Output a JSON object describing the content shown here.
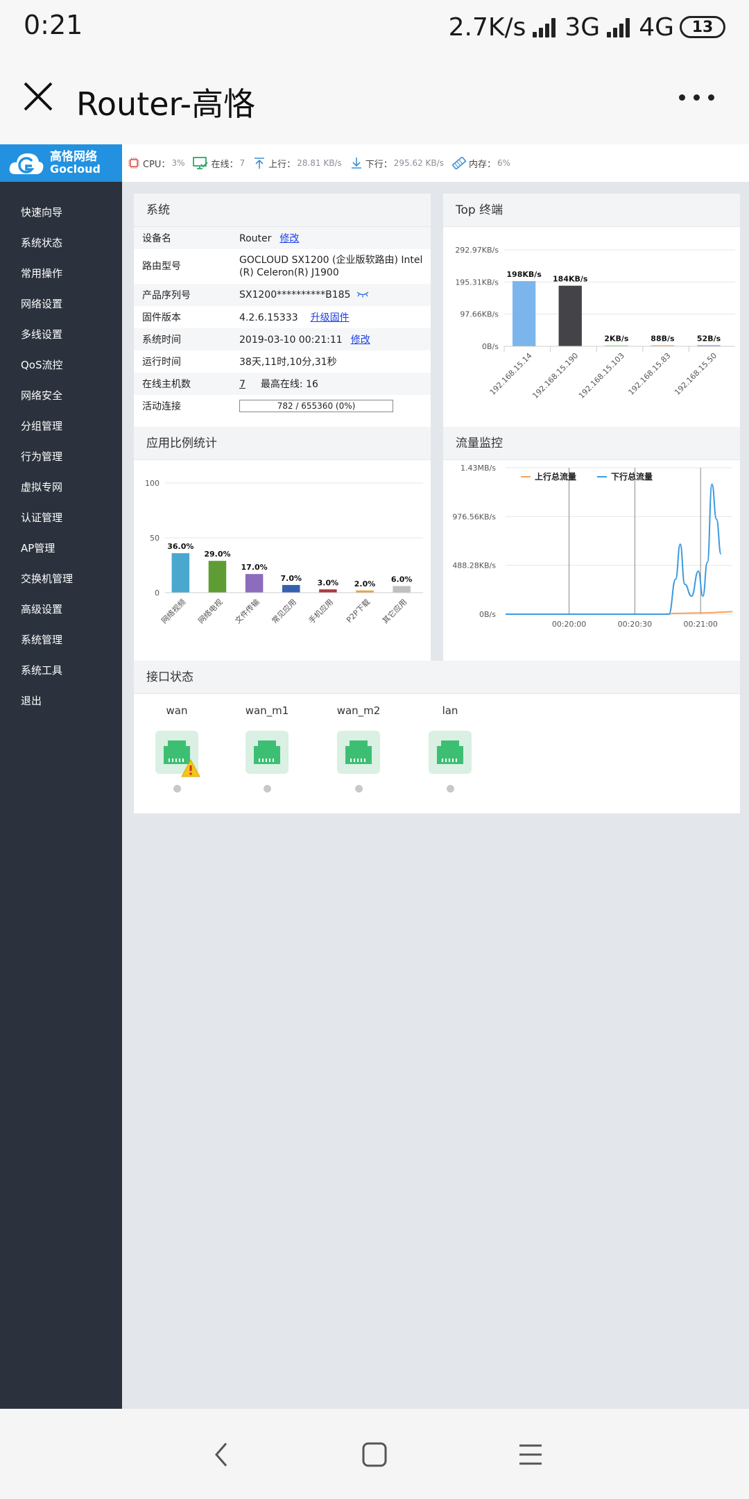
{
  "status_bar": {
    "time": "0:21",
    "net_speed": "2.7K/s",
    "net1": "3G",
    "net2": "4G",
    "battery": "13"
  },
  "title_bar": {
    "title": "Router-高恪"
  },
  "logo": {
    "cn": "高恪网络",
    "en": "Gocloud"
  },
  "sidebar": {
    "items": [
      "快速向导",
      "系统状态",
      "常用操作",
      "网络设置",
      "多线设置",
      "QoS流控",
      "网络安全",
      "分组管理",
      "行为管理",
      "虚拟专网",
      "认证管理",
      "AP管理",
      "交换机管理",
      "高级设置",
      "系统管理",
      "系统工具",
      "退出"
    ]
  },
  "topbar": {
    "cpu_label": "CPU：",
    "cpu": "3%",
    "online_label": "在线：",
    "online": "7",
    "up_label": "上行：",
    "up": "28.81 KB/s",
    "down_label": "下行：",
    "down": "295.62 KB/s",
    "mem_label": "内存：",
    "mem": "6%"
  },
  "system": {
    "title": "系统",
    "rows": [
      {
        "k": "设备名",
        "v": "Router",
        "link": "修改"
      },
      {
        "k": "路由型号",
        "v": "GOCLOUD SX1200 (企业版软路由) Intel(R) Celeron(R) J1900"
      },
      {
        "k": "产品序列号",
        "v": "SX1200**********B185"
      },
      {
        "k": "固件版本",
        "v": "4.2.6.15333",
        "link": "升级固件"
      },
      {
        "k": "系统时间",
        "v": "2019-03-10 00:21:11",
        "link": "修改"
      },
      {
        "k": "运行时间",
        "v": "38天,11时,10分,31秒"
      },
      {
        "k": "在线主机数",
        "v": "7",
        "extra_label": "最高在线:",
        "extra_value": "16"
      },
      {
        "k": "活动连接",
        "v": "782 / 655360 (0%)"
      }
    ]
  },
  "top_terminals": {
    "title": "Top 终端"
  },
  "app_stats": {
    "title": "应用比例统计"
  },
  "traffic": {
    "title": "流量监控"
  },
  "interfaces": {
    "title": "接口状态",
    "items": [
      {
        "name": "wan",
        "warning": true
      },
      {
        "name": "wan_m1",
        "warning": false
      },
      {
        "name": "wan_m2",
        "warning": false
      },
      {
        "name": "lan",
        "warning": false
      }
    ]
  },
  "colors": {
    "accent": "#2291e0",
    "sidebar": "#2b323d",
    "port_green": "#3dbf73"
  },
  "chart_data": [
    {
      "type": "bar",
      "title": "Top 终端",
      "categories": [
        "192.168.15.14",
        "192.168.15.190",
        "192.168.15.103",
        "192.168.15.83",
        "192.168.15.50"
      ],
      "values": [
        198,
        184,
        2,
        0.086,
        0.051
      ],
      "value_labels": [
        "198KB/s",
        "184KB/s",
        "2KB/s",
        "88B/s",
        "52B/s"
      ],
      "bar_colors": [
        "#7cb5ec",
        "#434348",
        "#90ed7d",
        "#f7a35c",
        "#8085e9"
      ],
      "y_ticks": [
        "0B/s",
        "97.66KB/s",
        "195.31KB/s",
        "292.97KB/s"
      ],
      "ylim": [
        0,
        292.97
      ]
    },
    {
      "type": "bar",
      "title": "应用比例统计",
      "categories": [
        "网络视频",
        "网络电视",
        "文件传输",
        "常见应用",
        "手机应用",
        "P2P下载",
        "其它应用"
      ],
      "values": [
        36.0,
        29.0,
        17.0,
        7.0,
        3.0,
        2.0,
        6.0
      ],
      "value_labels": [
        "36.0%",
        "29.0%",
        "17.0%",
        "7.0%",
        "3.0%",
        "2.0%",
        "6.0%"
      ],
      "bar_colors": [
        "#4aa8cf",
        "#5e9d33",
        "#8c6cbd",
        "#3561b1",
        "#b0363a",
        "#f0a038",
        "#bfbfbf"
      ],
      "y_ticks": [
        "0",
        "50",
        "100"
      ],
      "ylim": [
        0,
        100
      ]
    },
    {
      "type": "line",
      "title": "流量监控",
      "legend": [
        "上行总流量",
        "下行总流量"
      ],
      "x_ticks": [
        "00:20:00",
        "00:20:30",
        "00:21:00"
      ],
      "y_ticks": [
        "0B/s",
        "488.28KB/s",
        "976.56KB/s",
        "1.43MB/s"
      ],
      "ylim": [
        0,
        1464.8
      ],
      "series": [
        {
          "name": "上行总流量",
          "color": "#f7a35c",
          "points": [
            [
              0,
              0
            ],
            [
              70,
              0
            ],
            [
              75,
              8
            ],
            [
              85,
              12
            ],
            [
              90,
              14
            ],
            [
              95,
              20
            ],
            [
              100,
              25
            ]
          ]
        },
        {
          "name": "下行总流量",
          "color": "#3b9ae1",
          "points": [
            [
              0,
              0
            ],
            [
              72,
              0
            ],
            [
              75,
              350
            ],
            [
              77,
              700
            ],
            [
              79,
              300
            ],
            [
              82,
              180
            ],
            [
              85,
              430
            ],
            [
              87,
              180
            ],
            [
              89,
              520
            ],
            [
              91,
              1300
            ],
            [
              93,
              950
            ],
            [
              95,
              600
            ]
          ]
        }
      ]
    }
  ]
}
